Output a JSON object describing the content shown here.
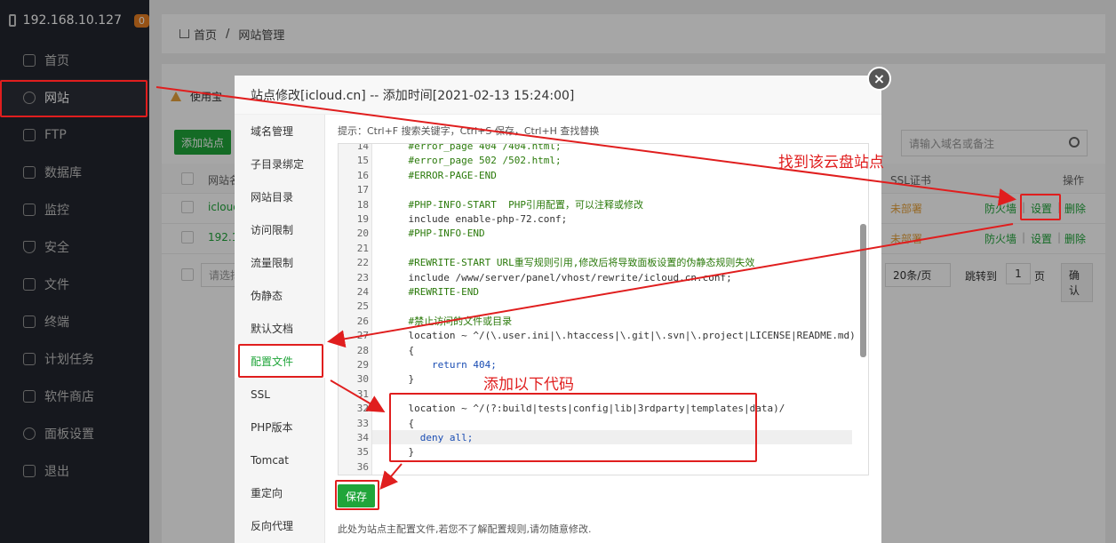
{
  "sidebar": {
    "host": "192.168.10.127",
    "badge": "0",
    "items": [
      {
        "label": "首页",
        "icon": "home-icon"
      },
      {
        "label": "网站",
        "icon": "globe-icon"
      },
      {
        "label": "FTP",
        "icon": "ftp-icon"
      },
      {
        "label": "数据库",
        "icon": "database-icon"
      },
      {
        "label": "监控",
        "icon": "monitor-icon"
      },
      {
        "label": "安全",
        "icon": "shield-icon"
      },
      {
        "label": "文件",
        "icon": "folder-icon"
      },
      {
        "label": "终端",
        "icon": "terminal-icon"
      },
      {
        "label": "计划任务",
        "icon": "calendar-icon"
      },
      {
        "label": "软件商店",
        "icon": "apps-icon"
      },
      {
        "label": "面板设置",
        "icon": "gear-icon"
      },
      {
        "label": "退出",
        "icon": "logout-icon"
      }
    ]
  },
  "breadcrumb": {
    "home": "首页",
    "sep": "/",
    "current": "网站管理"
  },
  "page": {
    "warn": "使用宝",
    "add_site": "添加站点",
    "search_placeholder": "请输入域名或备注",
    "headers": {
      "name": "网站名",
      "ssl": "SSL证书",
      "ops": "操作"
    },
    "rows": [
      {
        "name": "icloud",
        "ssl": "未部署",
        "firewall": "防火墙",
        "settings": "设置",
        "delete": "删除"
      },
      {
        "name": "192.16",
        "ssl": "未部署",
        "firewall": "防火墙",
        "settings": "设置",
        "delete": "删除"
      }
    ],
    "batch_placeholder": "请选择",
    "per_page": "20条/页",
    "goto": "跳转到",
    "page_num": "1",
    "page_unit": "页",
    "confirm": "确认"
  },
  "modal": {
    "title": "站点修改[icloud.cn] -- 添加时间[2021-02-13 15:24:00]",
    "close": "×",
    "menu": [
      "域名管理",
      "子目录绑定",
      "网站目录",
      "访问限制",
      "流量限制",
      "伪静态",
      "默认文档",
      "配置文件",
      "SSL",
      "PHP版本",
      "Tomcat",
      "重定向",
      "反向代理"
    ],
    "hint": "提示：Ctrl+F 搜索关键字，Ctrl+S 保存，Ctrl+H 查找替换",
    "lines": [
      {
        "n": "14",
        "t": "    #error_page 404 /404.html;",
        "c": "comment"
      },
      {
        "n": "15",
        "t": "    #error_page 502 /502.html;",
        "c": "comment"
      },
      {
        "n": "16",
        "t": "    #ERROR-PAGE-END",
        "c": "comment"
      },
      {
        "n": "17",
        "t": "",
        "c": ""
      },
      {
        "n": "18",
        "t": "    #PHP-INFO-START  PHP引用配置，可以注释或修改",
        "c": "comment"
      },
      {
        "n": "19",
        "t": "    include enable-php-72.conf;",
        "c": ""
      },
      {
        "n": "20",
        "t": "    #PHP-INFO-END",
        "c": "comment"
      },
      {
        "n": "21",
        "t": "",
        "c": ""
      },
      {
        "n": "22",
        "t": "    #REWRITE-START URL重写规则引用,修改后将导致面板设置的伪静态规则失效",
        "c": "comment"
      },
      {
        "n": "23",
        "t": "    include /www/server/panel/vhost/rewrite/icloud.cn.conf;",
        "c": ""
      },
      {
        "n": "24",
        "t": "    #REWRITE-END",
        "c": "comment"
      },
      {
        "n": "25",
        "t": "",
        "c": ""
      },
      {
        "n": "26",
        "t": "    #禁止访问的文件或目录",
        "c": "comment"
      },
      {
        "n": "27",
        "t": "    location ~ ^/(\\.user.ini|\\.htaccess|\\.git|\\.svn|\\.project|LICENSE|README.md)",
        "c": ""
      },
      {
        "n": "28",
        "t": "    {",
        "c": ""
      },
      {
        "n": "29",
        "t": "        return 404;",
        "c": "blue"
      },
      {
        "n": "30",
        "t": "    }",
        "c": ""
      },
      {
        "n": "31",
        "t": "",
        "c": ""
      },
      {
        "n": "32",
        "t": "    location ~ ^/(?:build|tests|config|lib|3rdparty|templates|data)/",
        "c": ""
      },
      {
        "n": "33",
        "t": "    {",
        "c": ""
      },
      {
        "n": "34",
        "t": "      deny all;",
        "c": "blue"
      },
      {
        "n": "35",
        "t": "    }",
        "c": ""
      },
      {
        "n": "36",
        "t": "",
        "c": ""
      }
    ],
    "save": "保存",
    "note": "此处为站点主配置文件,若您不了解配置规则,请勿随意修改."
  },
  "annotations": {
    "find_site": "找到该云盘站点",
    "add_code": "添加以下代码"
  },
  "colors": {
    "accent": "#20a53a",
    "annotation": "#e01e1e",
    "sidebar_bg": "#23262e"
  }
}
